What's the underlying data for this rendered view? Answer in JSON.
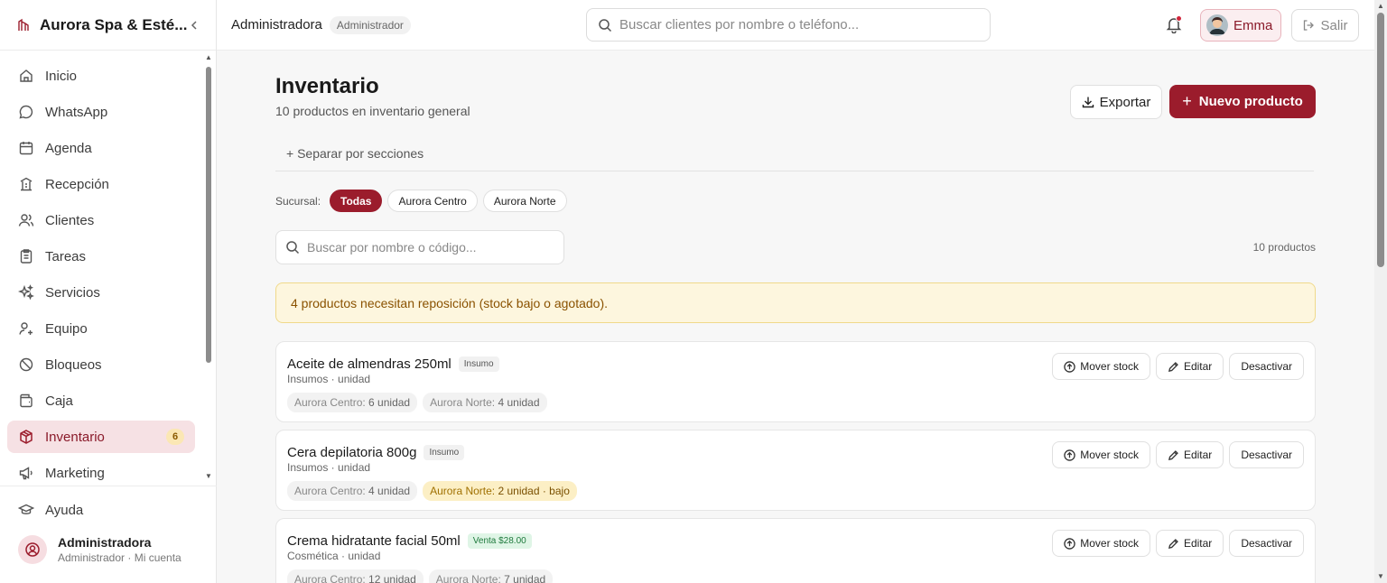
{
  "brand": {
    "name": "Aurora Spa & Esté..."
  },
  "sidebar": {
    "items": [
      {
        "label": "Inicio",
        "icon": "home-icon"
      },
      {
        "label": "WhatsApp",
        "icon": "chat-icon"
      },
      {
        "label": "Agenda",
        "icon": "calendar-icon"
      },
      {
        "label": "Recepción",
        "icon": "reception-icon"
      },
      {
        "label": "Clientes",
        "icon": "users-icon"
      },
      {
        "label": "Tareas",
        "icon": "clipboard-icon"
      },
      {
        "label": "Servicios",
        "icon": "sparkles-icon"
      },
      {
        "label": "Equipo",
        "icon": "team-icon"
      },
      {
        "label": "Bloqueos",
        "icon": "ban-icon"
      },
      {
        "label": "Caja",
        "icon": "wallet-icon"
      },
      {
        "label": "Inventario",
        "icon": "box-icon",
        "badge": "6",
        "active": true
      },
      {
        "label": "Marketing",
        "icon": "megaphone-icon"
      }
    ],
    "help": "Ayuda",
    "account": {
      "name": "Administradora",
      "sub": "Administrador · Mi cuenta"
    }
  },
  "header": {
    "user": "Administradora",
    "role": "Administrador",
    "search_placeholder": "Buscar clientes por nombre o teléfono...",
    "profile": "Emma",
    "logout": "Salir"
  },
  "main": {
    "title": "Inventario",
    "subtitle": "10 productos en inventario general",
    "export_label": "Exportar",
    "new_label": "Nuevo producto",
    "sections_link": "+ Separar por secciones",
    "branch_label": "Sucursal:",
    "branches": [
      "Todas",
      "Aurora Centro",
      "Aurora Norte"
    ],
    "search_placeholder": "Buscar por nombre o código...",
    "count": "10 productos",
    "alert": "4 productos necesitan reposición (stock bajo o agotado).",
    "actions": {
      "move": "Mover stock",
      "edit": "Editar",
      "deactivate": "Desactivar"
    },
    "products": [
      {
        "name": "Aceite de almendras 250ml",
        "tag": "Insumo",
        "meta": "Insumos · unidad",
        "stocks": [
          {
            "label": "Aurora Centro:",
            "value": "6 unidad",
            "low": false
          },
          {
            "label": "Aurora Norte:",
            "value": "4 unidad",
            "low": false
          }
        ]
      },
      {
        "name": "Cera depilatoria 800g",
        "tag": "Insumo",
        "meta": "Insumos · unidad",
        "stocks": [
          {
            "label": "Aurora Centro:",
            "value": "4 unidad",
            "low": false
          },
          {
            "label": "Aurora Norte:",
            "value": "2 unidad · bajo",
            "low": true
          }
        ]
      },
      {
        "name": "Crema hidratante facial 50ml",
        "tag": "Venta $28.00",
        "meta": "Cosmética · unidad",
        "stocks": [
          {
            "label": "Aurora Centro:",
            "value": "12 unidad",
            "low": false
          },
          {
            "label": "Aurora Norte:",
            "value": "7 unidad",
            "low": false
          }
        ]
      }
    ]
  },
  "colors": {
    "brand": "#9b1c2c",
    "alert_bg": "#fdf6de",
    "sale_tag": "#dff5e6",
    "low_stock": "#fcefc5"
  }
}
